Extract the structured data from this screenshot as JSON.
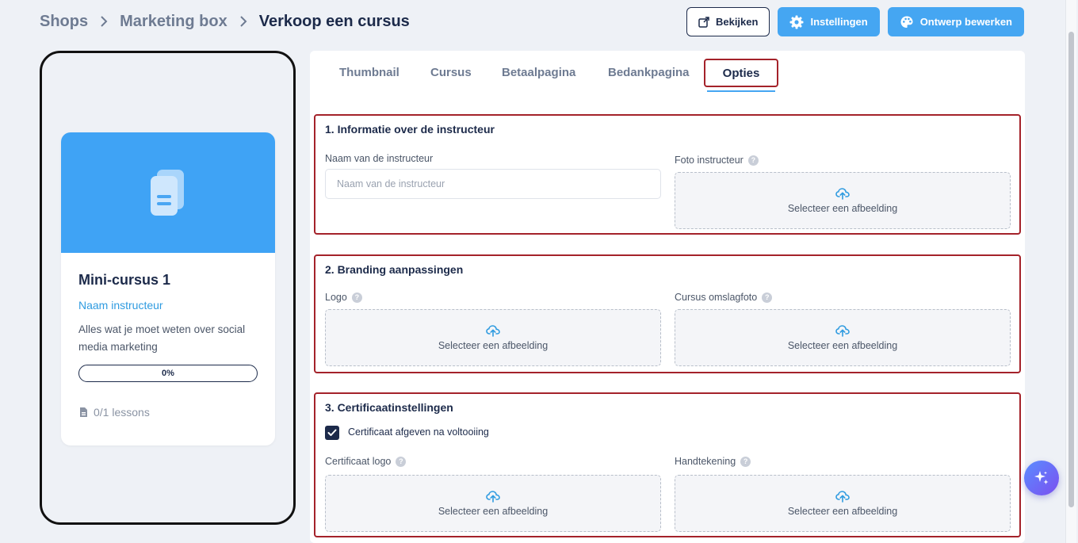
{
  "breadcrumb": {
    "items": [
      "Shops",
      "Marketing box"
    ],
    "current": "Verkoop een cursus"
  },
  "header": {
    "view_label": "Bekijken",
    "settings_label": "Instellingen",
    "design_label": "Ontwerp bewerken"
  },
  "preview": {
    "title": "Mini-cursus 1",
    "instructor": "Naam instructeur",
    "description": "Alles wat je moet weten over social media marketing",
    "progress_text": "0%",
    "progress": 0,
    "lessons": "0/1 lessons"
  },
  "tabs": {
    "thumbnail": "Thumbnail",
    "cursus": "Cursus",
    "betaalpagina": "Betaalpagina",
    "bedankpagina": "Bedankpagina",
    "opties": "Opties"
  },
  "sections": {
    "instructor": {
      "title": "1. Informatie over de instructeur",
      "name_label": "Naam van de instructeur",
      "name_placeholder": "Naam van de instructeur",
      "name_value": "",
      "photo_label": "Foto instructeur"
    },
    "branding": {
      "title": "2. Branding aanpassingen",
      "logo_label": "Logo",
      "cover_label": "Cursus omslagfoto"
    },
    "certificate": {
      "title": "3. Certificaatinstellingen",
      "checkbox_label": "Certificaat afgeven na voltooiing",
      "checked": true,
      "logo_label": "Certificaat logo",
      "signature_label": "Handtekening"
    }
  },
  "upload_text": "Selecteer een afbeelding",
  "help_glyph": "?",
  "colors": {
    "accent": "#45a6f2",
    "navy": "#1c2a4a",
    "highlight": "#a4222a"
  }
}
